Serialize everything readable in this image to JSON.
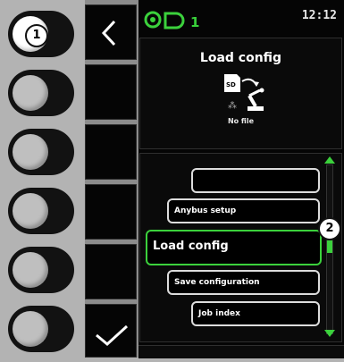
{
  "header": {
    "channel_number": "1",
    "time": "12:12"
  },
  "badges": {
    "button_marker": "1",
    "scroll_marker": "2"
  },
  "panel": {
    "title": "Load config",
    "file_status": "No file",
    "icon_label": "SD"
  },
  "menu": {
    "items": [
      {
        "label": ""
      },
      {
        "label": "Anybus setup"
      },
      {
        "label": "Load config"
      },
      {
        "label": "Save configuration"
      },
      {
        "label": "Job index"
      }
    ],
    "selected_index": 2
  },
  "colors": {
    "accent_green": "#3bd13c",
    "text_white": "#ffffff",
    "screen_bg": "#050505"
  },
  "icons": [
    "back-chevron-icon",
    "confirm-check-icon",
    "wire-feeder-icon",
    "sd-card-icon",
    "robot-arm-icon",
    "scroll-up-arrow-icon",
    "scroll-down-arrow-icon"
  ]
}
